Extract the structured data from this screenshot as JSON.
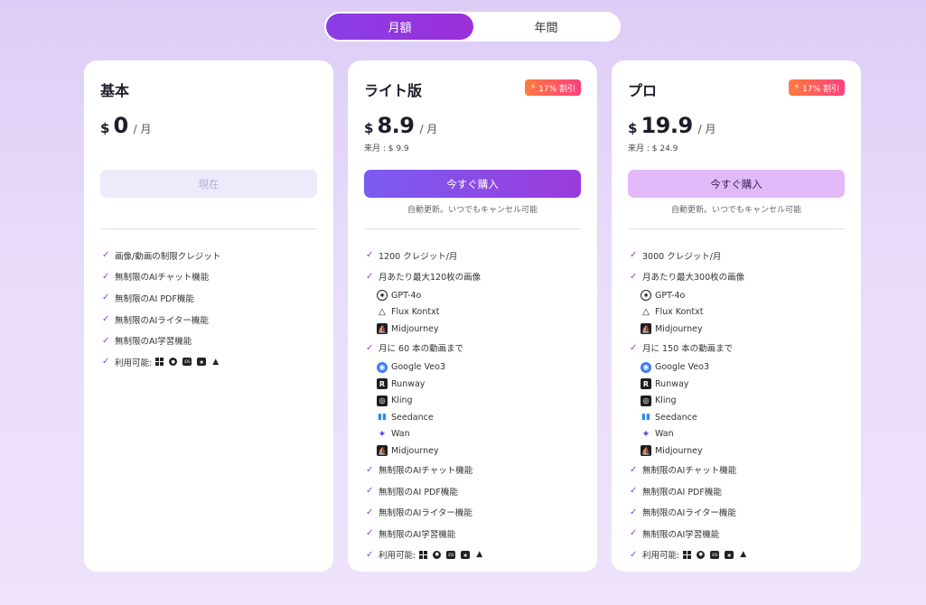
{
  "billing_toggle": {
    "monthly": "月額",
    "yearly": "年間"
  },
  "plans": {
    "basic": {
      "name": "基本",
      "currency": "$",
      "price": "0",
      "per": "/ 月",
      "button": "現在",
      "features": [
        "画像/動画の制限クレジット",
        "無制限のAIチャット機能",
        "無制限のAI PDF機能",
        "無制限のAIライター機能",
        "無制限のAI学習機能",
        "利用可能:"
      ]
    },
    "lite": {
      "name": "ライト版",
      "discount": "17% 割引",
      "currency": "$",
      "price": "8.9",
      "per": "/ 月",
      "next_month": "来月 : $ 9.9",
      "button": "今すぐ購入",
      "auto_renew": "自動更新。いつでもキャンセル可能",
      "credits": "1200 クレジット/月",
      "images": "月あたり最大120枚の画像",
      "image_models": [
        "GPT-4o",
        "Flux Kontxt",
        "Midjourney"
      ],
      "videos": "月に 60 本の動画まで",
      "video_models": [
        "Google Veo3",
        "Runway",
        "Kling",
        "Seedance",
        "Wan",
        "Midjourney"
      ],
      "features": [
        "無制限のAIチャット機能",
        "無制限のAI PDF機能",
        "無制限のAIライター機能",
        "無制限のAI学習機能",
        "利用可能:"
      ]
    },
    "pro": {
      "name": "プロ",
      "discount": "17% 割引",
      "currency": "$",
      "price": "19.9",
      "per": "/ 月",
      "next_month": "来月 : $ 24.9",
      "button": "今すぐ購入",
      "auto_renew": "自動更新。いつでもキャンセル可能",
      "credits": "3000 クレジット/月",
      "images": "月あたり最大300枚の画像",
      "image_models": [
        "GPT-4o",
        "Flux Kontxt",
        "Midjourney"
      ],
      "videos": "月に 150 本の動画まで",
      "video_models": [
        "Google Veo3",
        "Runway",
        "Kling",
        "Seedance",
        "Wan",
        "Midjourney"
      ],
      "features": [
        "無制限のAIチャット機能",
        "無制限のAI PDF機能",
        "無制限のAIライター機能",
        "無制限のAI学習機能",
        "利用可能:"
      ]
    }
  },
  "platform_icons": [
    "windows-icon",
    "macos-icon",
    "ios-icon",
    "android-store-icon",
    "android-icon"
  ],
  "colors": {
    "accent": "#8a3ee6",
    "discount": "#ff5a5f",
    "soft_button": "#e2b9f8"
  }
}
